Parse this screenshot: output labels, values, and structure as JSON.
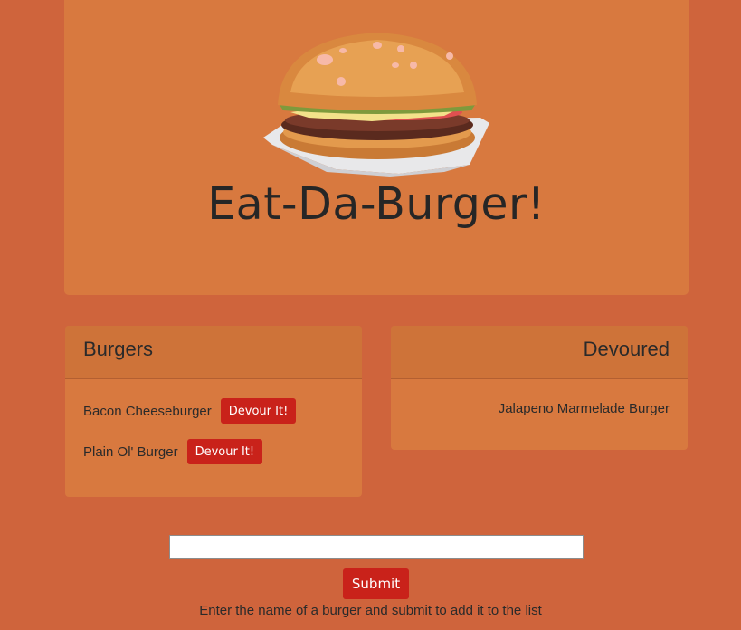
{
  "hero": {
    "title": "Eat-Da-Burger!",
    "image_icon": "hamburger-icon"
  },
  "burgers_panel": {
    "heading": "Burgers",
    "items": [
      {
        "name": "Bacon Cheeseburger",
        "button_label": "Devour It!"
      },
      {
        "name": "Plain Ol' Burger",
        "button_label": "Devour It!"
      }
    ]
  },
  "devoured_panel": {
    "heading": "Devoured",
    "items": [
      {
        "name": "Jalapeno Marmelade Burger"
      }
    ]
  },
  "form": {
    "input_value": "",
    "input_placeholder": "",
    "submit_label": "Submit",
    "helper_text": "Enter the name of a burger and submit to add it to the list"
  },
  "colors": {
    "page_background": "#cf643c",
    "panel_background": "#d8793f",
    "button_red": "#c9221a"
  }
}
